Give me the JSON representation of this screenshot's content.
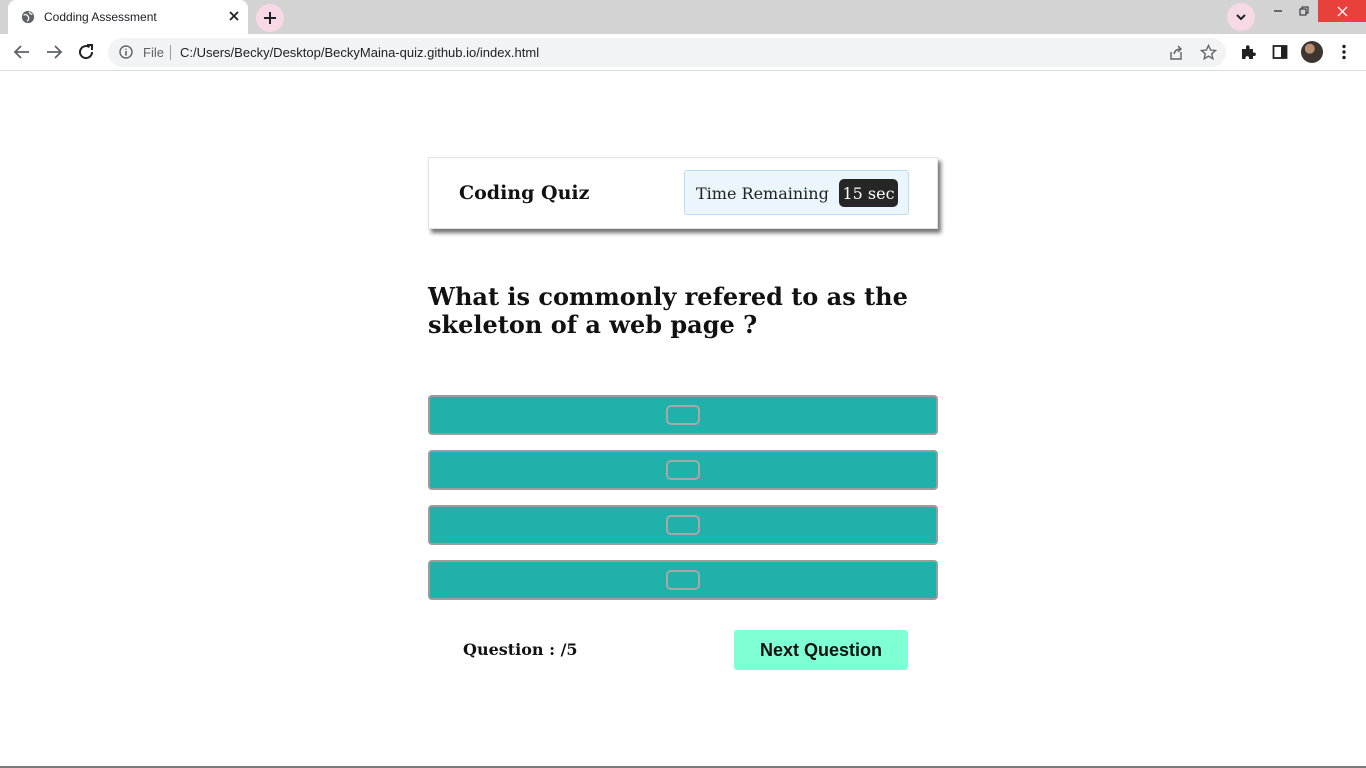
{
  "browser": {
    "tab_title": "Codding Assessment",
    "omnibox_scheme": "File",
    "url": "C:/Users/Becky/Desktop/BeckyMaina-quiz.github.io/index.html",
    "accent_colors": {
      "tab_search_bg": "#f7d8e6",
      "close_button": "#e8403a"
    }
  },
  "quiz": {
    "title": "Coding Quiz",
    "timer_label": "Time Remaining",
    "timer_value": "15 sec",
    "question": "What is commonly refered to as the skeleton of a web page ?",
    "answers": [
      {
        "label": ""
      },
      {
        "label": ""
      },
      {
        "label": ""
      },
      {
        "label": ""
      }
    ],
    "progress": "Question : /5",
    "next_label": "Next Question",
    "colors": {
      "answer_bg": "#20b2aa",
      "next_bg": "#7fffd4",
      "timer_bg": "#262626"
    }
  }
}
